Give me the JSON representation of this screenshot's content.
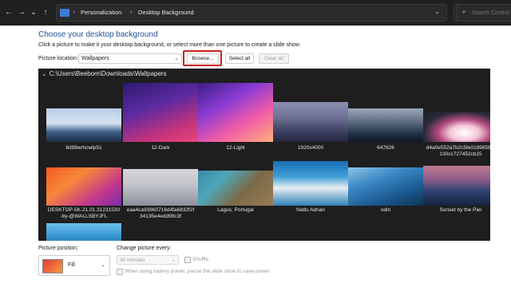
{
  "address_bar": {
    "crumbs": [
      "Personalization",
      "Desktop Background"
    ],
    "search_placeholder": "Search Control Pa"
  },
  "icons": {
    "back": "←",
    "forward": "→",
    "history": "⌄",
    "up": "↑",
    "sep": "›",
    "dropdown": "⌄",
    "refresh": "↻",
    "search": "⌕",
    "chevron": "⌄"
  },
  "page": {
    "title": "Choose your desktop background",
    "subtitle": "Click a picture to make it your desktop background, or select more than one picture to create a slide show."
  },
  "picture_location": {
    "label": "Picture location:",
    "value": "Wallpapers",
    "browse_label": "Browse...",
    "select_all_label": "Select all",
    "clear_all_label": "Clear all"
  },
  "gallery": {
    "folder_path": "C:\\Users\\Beebom\\Downloads\\Wallpapers",
    "items": [
      {
        "label": "8d98wrhcwlp51",
        "label2": ""
      },
      {
        "label": "12-Dark",
        "label2": ""
      },
      {
        "label": "12-Light",
        "label2": ""
      },
      {
        "label": "1920x4000",
        "label2": ""
      },
      {
        "label": "647826",
        "label2": ""
      },
      {
        "label": "d4a0e552a7b2c5fe01898585f",
        "label2": "130cc727452cb15"
      },
      {
        "label": "DESKTOP-5K-21.01.31231530",
        "label2": "-by-@WALLSBYJFL"
      },
      {
        "label": "eaa4ca93860716d4fa6832f2f",
        "label2": "34135e4edd99c3f"
      },
      {
        "label": "Lagos, Portugal",
        "label2": ""
      },
      {
        "label": "Nattu Adnan",
        "label2": ""
      },
      {
        "label": "odin",
        "label2": ""
      },
      {
        "label": "Sunset by the Pier",
        "label2": ""
      }
    ]
  },
  "picture_position": {
    "label": "Picture position:",
    "value": "Fill"
  },
  "slideshow": {
    "label": "Change picture every:",
    "interval": "30 minutes",
    "shuffle_label": "Shuffle",
    "battery_label": "When using battery power, pause the slide show to save power"
  }
}
